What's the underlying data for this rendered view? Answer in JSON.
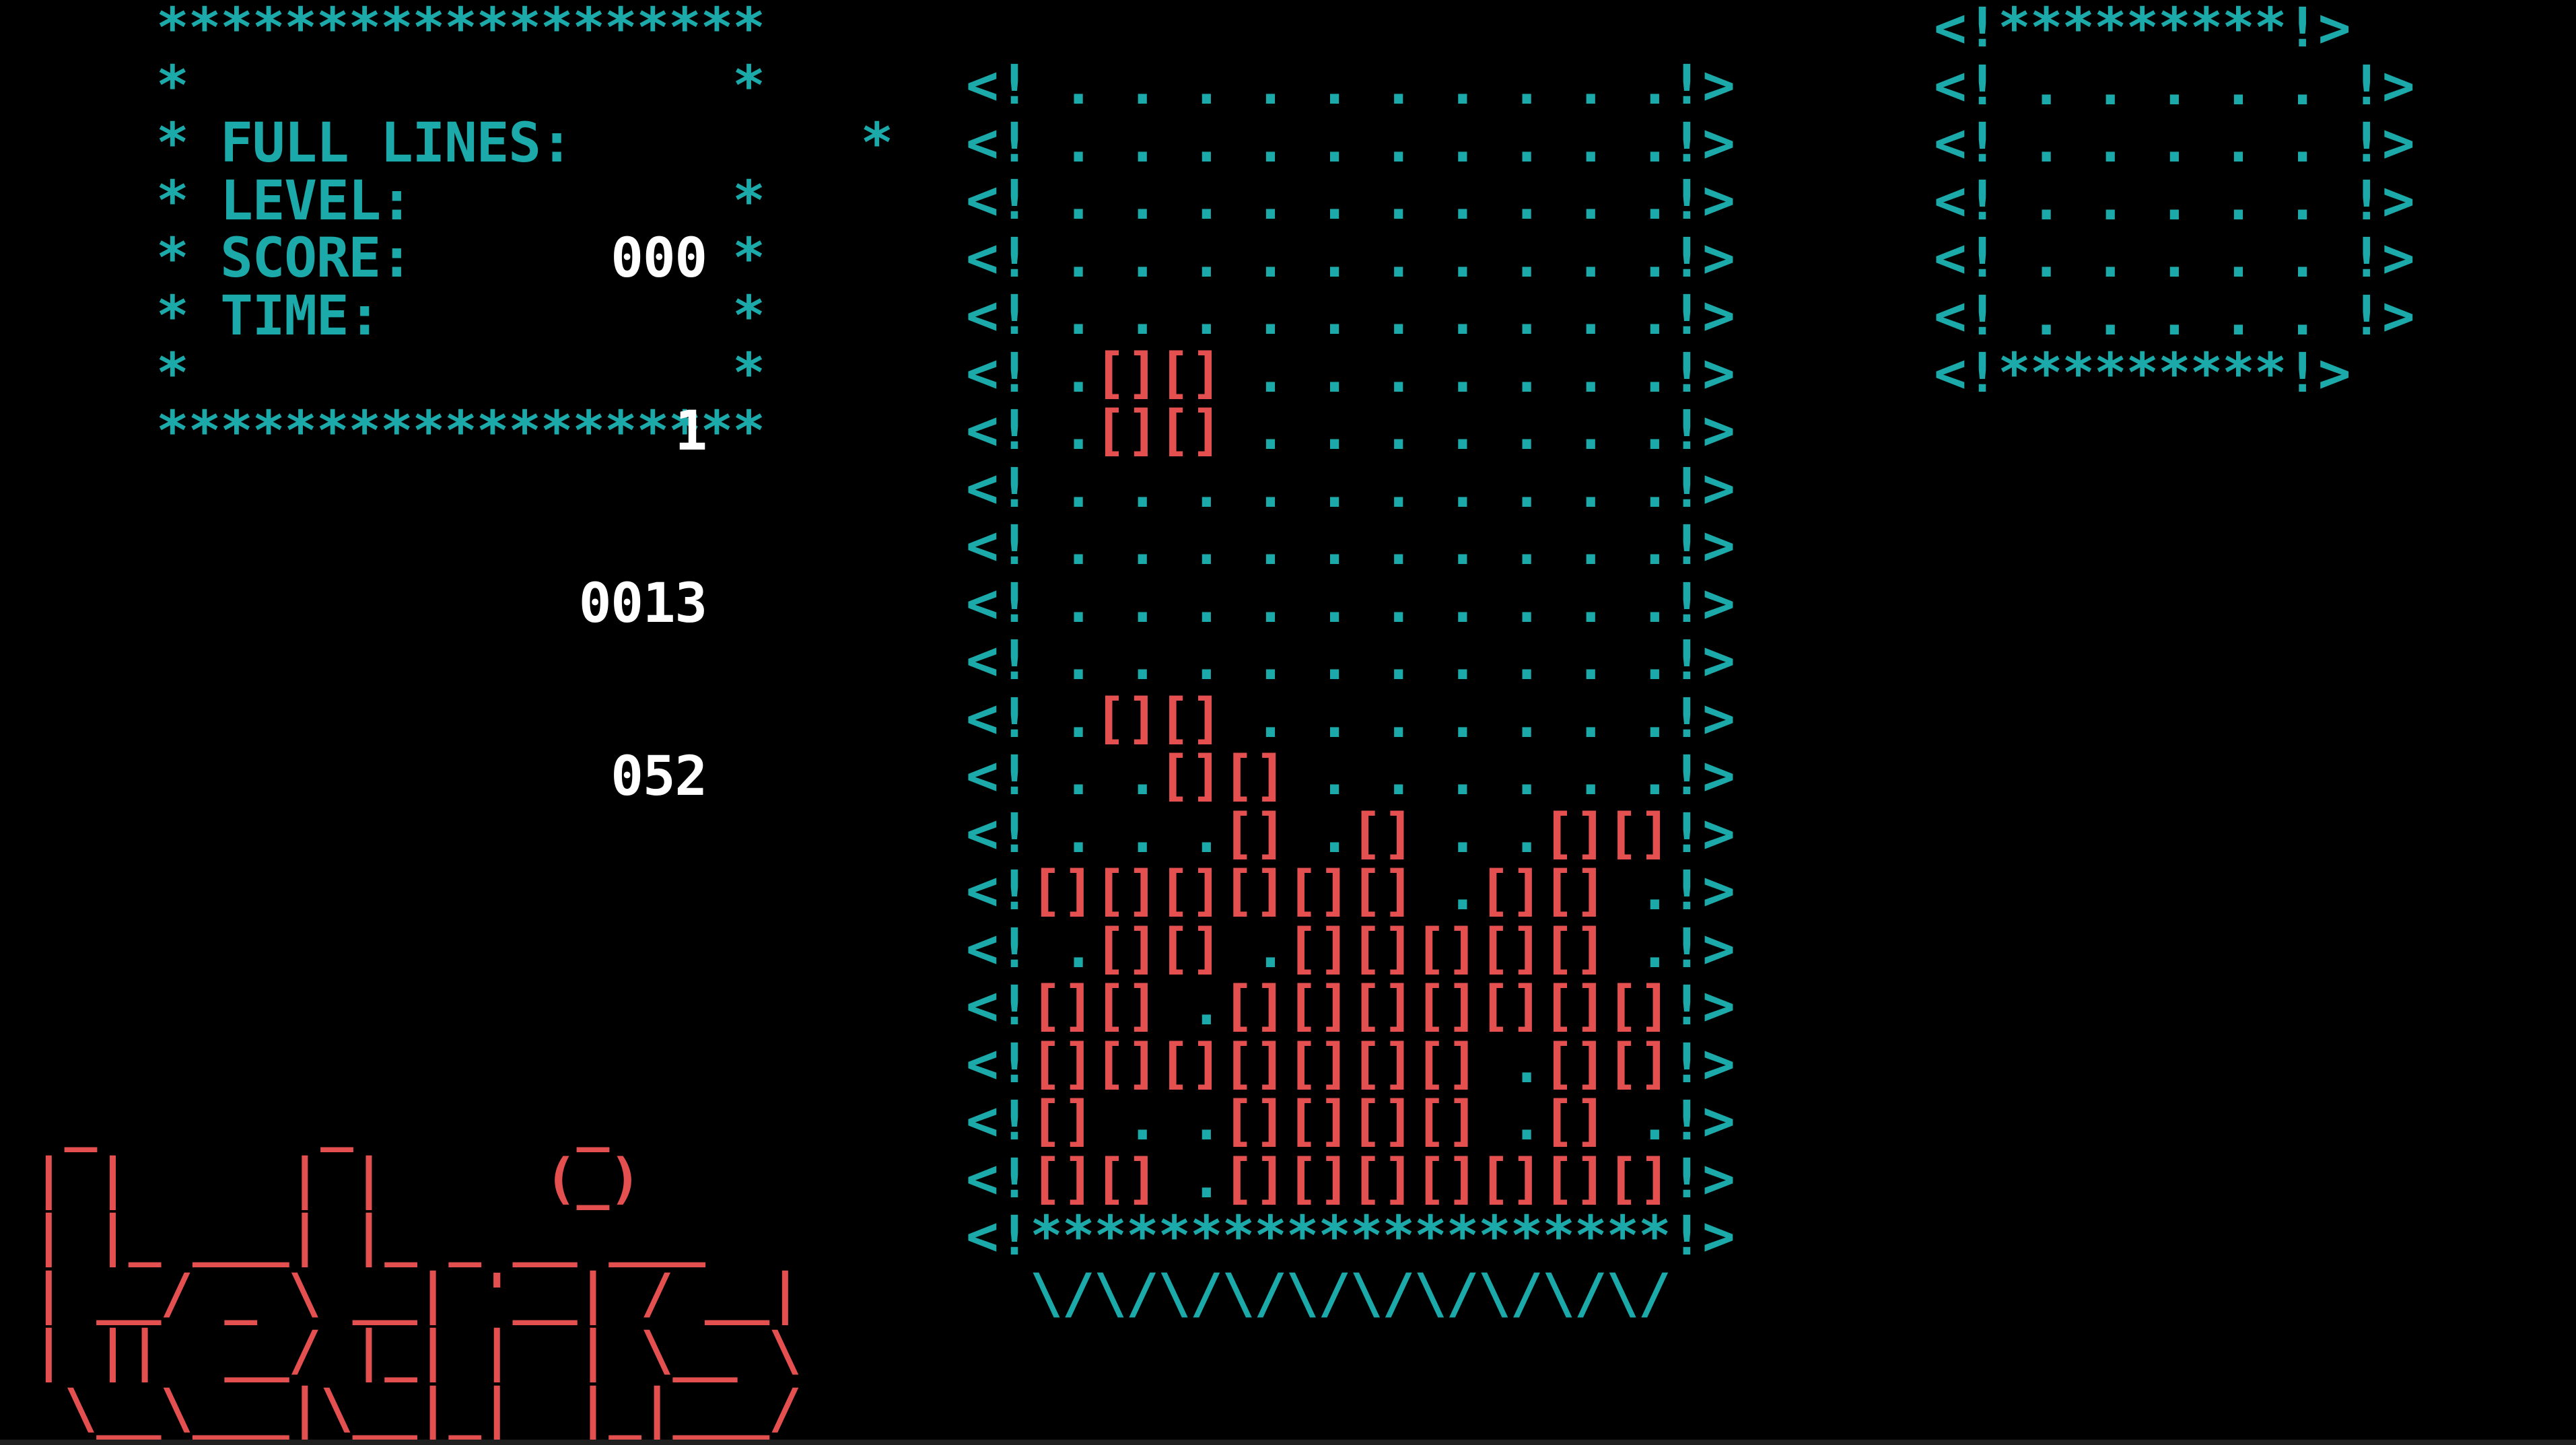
{
  "stats": {
    "labels": {
      "full_lines": "FULL LINES:",
      "level": "LEVEL:",
      "score": "SCORE:",
      "time": "TIME:"
    },
    "values": {
      "full_lines": "000",
      "level": "1",
      "score": "0013",
      "time": "052"
    }
  },
  "well": {
    "left_wall": "<!",
    "right_wall": "!>",
    "empty_cell": " .",
    "filled_cell": "[]",
    "floor_fill": "*",
    "bottom_edge": "\\/",
    "rows": [
      "..........",
      "..........",
      "..........",
      "..........",
      "..........",
      ".##.......",
      ".##.......",
      "..........",
      "..........",
      "..........",
      "..........",
      ".##.......",
      "..##......",
      "...#.#..##",
      "######.##.",
      ".##.#####.",
      "##.#######",
      "#######.##",
      "#..####.#.",
      "##.#######"
    ]
  },
  "next_box": {
    "top": "<!*********!>",
    "rows": [
      "<! . . . . . !>",
      "<! . . . . . !>",
      "<! . . . . . !>",
      "<! . . . . . !>",
      "<! . . . . . !>"
    ],
    "bottom": "<!*********!>"
  },
  "logo": {
    "name": "tetris",
    "lines": [
      " _       _       _  ",
      "| |     | |     (_) ",
      "| |_ ___| |_ _ __ ___",
      "| __/ _ \\ __| '__| / __|",
      "| ||  __/ |_| |  | \\__ \\",
      " \\__\\___|\\__|_|  |_|___/"
    ]
  },
  "colors": {
    "border": "#1ba9a9",
    "blocks": "#e4504f",
    "values": "#ffffff",
    "background": "#000000"
  }
}
